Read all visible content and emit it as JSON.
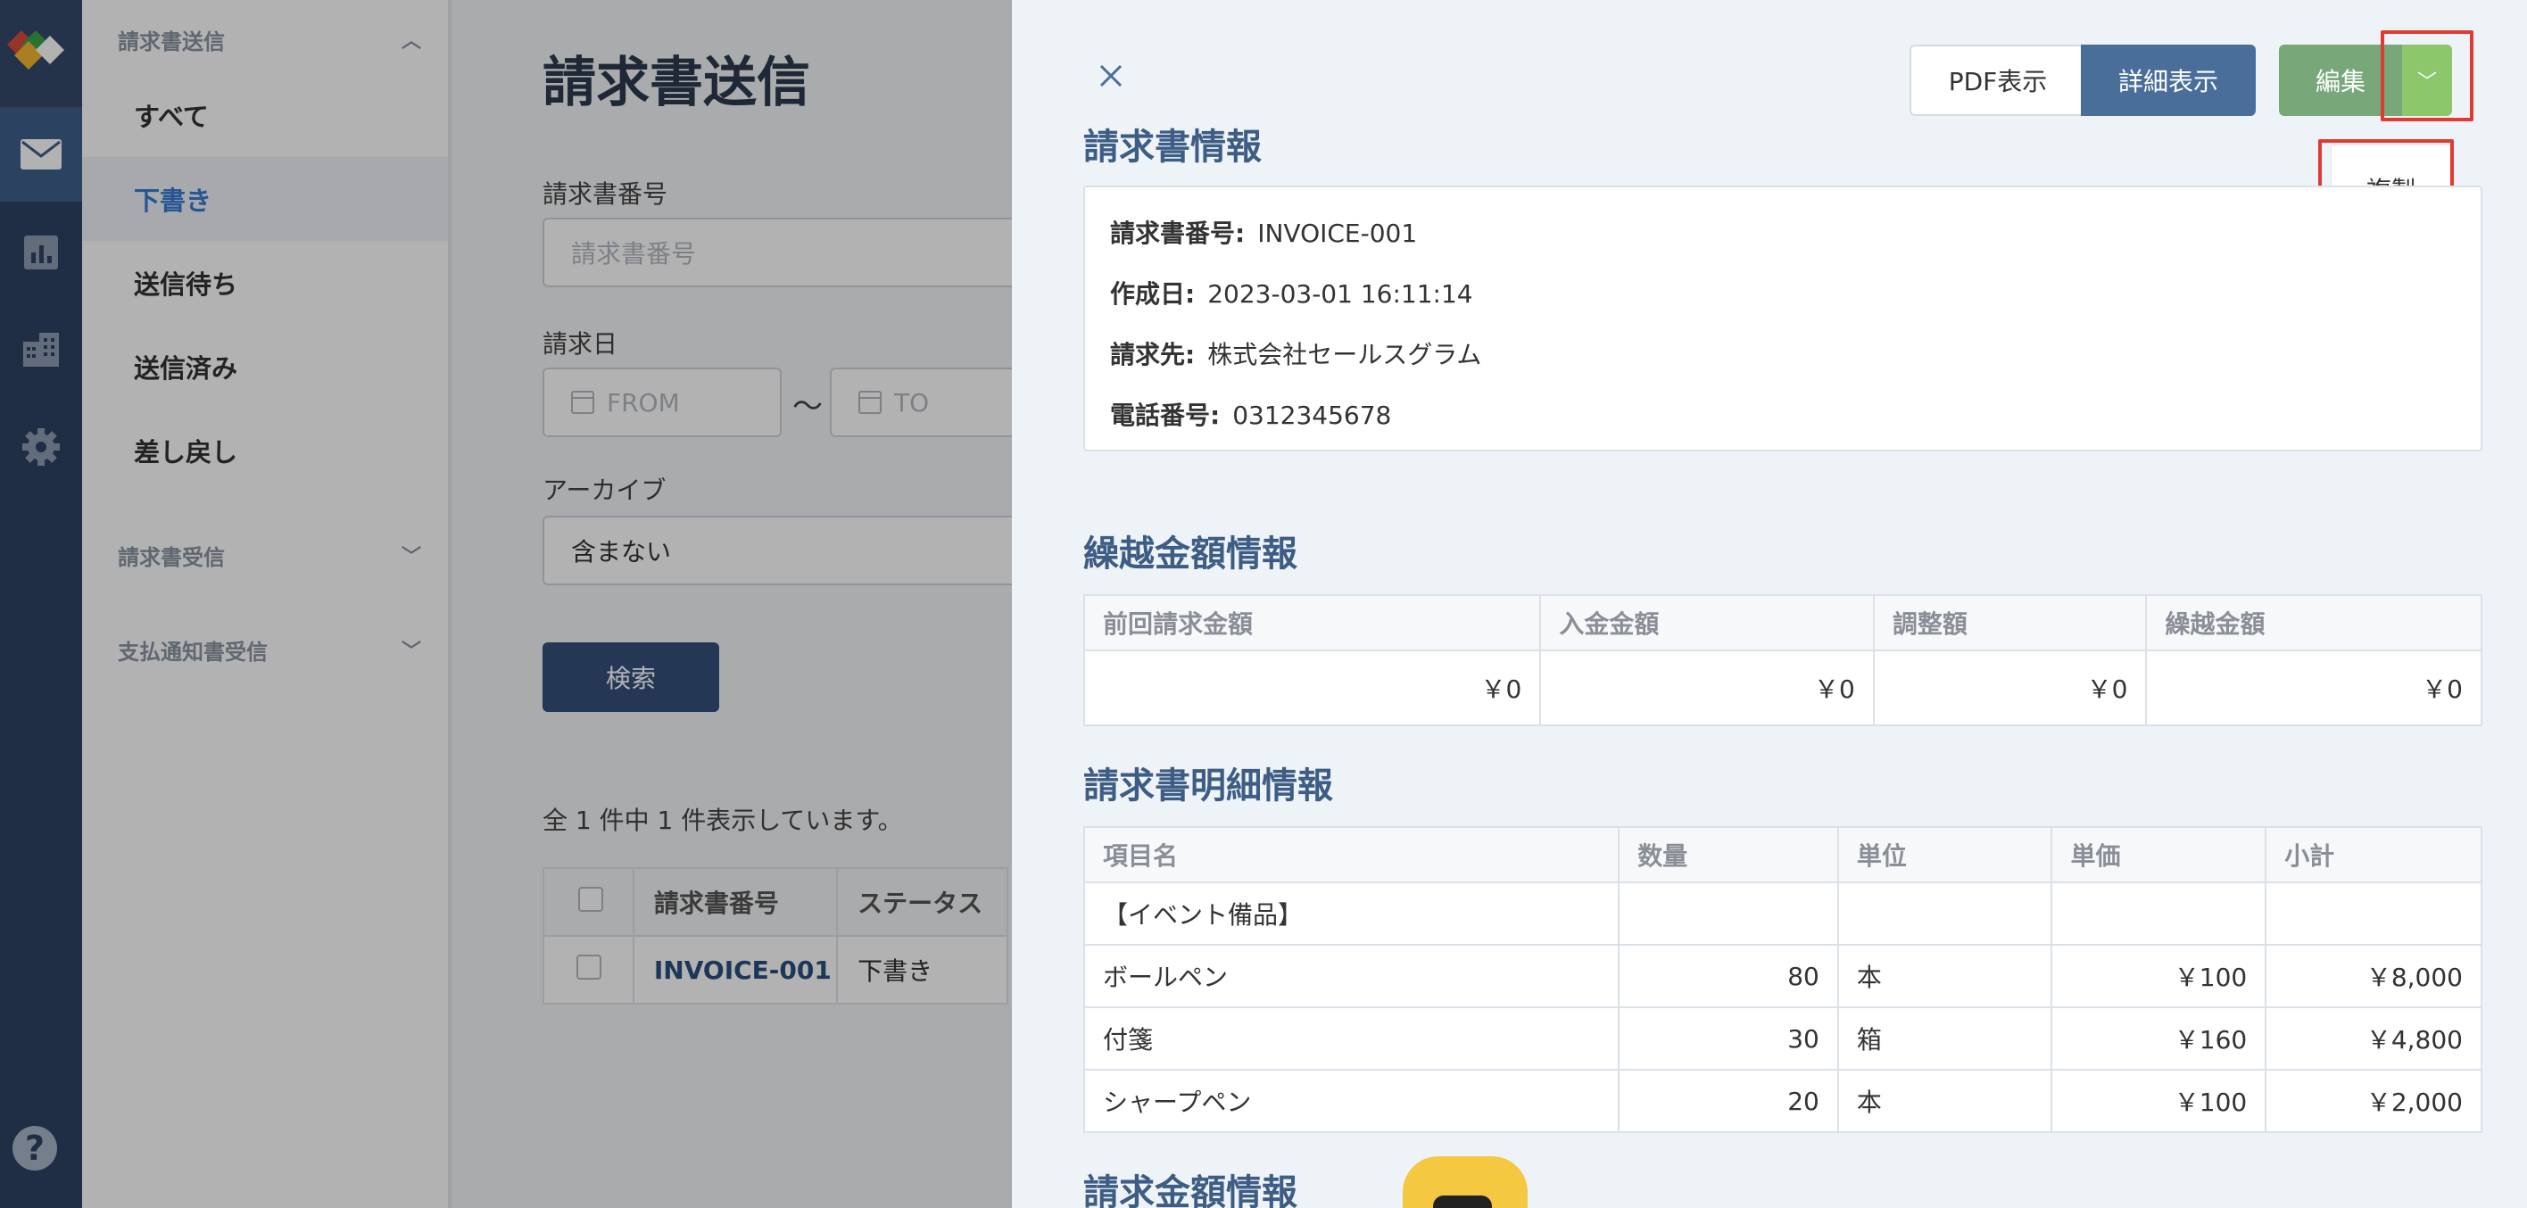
{
  "sidebar": {
    "group_sending": "請求書送信",
    "items": [
      {
        "label": "すべて"
      },
      {
        "label": "下書き"
      },
      {
        "label": "送信待ち"
      },
      {
        "label": "送信済み"
      },
      {
        "label": "差し戻し"
      }
    ],
    "group_receiving": "請求書受信",
    "group_payment": "支払通知書受信"
  },
  "main": {
    "title": "請求書送信",
    "invoice_no_label": "請求書番号",
    "invoice_no_placeholder": "請求書番号",
    "date_label": "請求日",
    "from_placeholder": "FROM",
    "tilde": "〜",
    "to_placeholder": "TO",
    "archive_label": "アーカイブ",
    "archive_value": "含まない",
    "search_button": "検索",
    "count_text": "全 1 件中 1 件表示しています。",
    "table": {
      "headers": [
        "請求書番号",
        "ステータス"
      ],
      "rows": [
        [
          "INVOICE-001",
          "下書き"
        ]
      ]
    }
  },
  "panel": {
    "pdf_button": "PDF表示",
    "detail_button": "詳細表示",
    "edit_button": "編集",
    "dropdown_item": "複製",
    "invoice_info_title": "請求書情報",
    "invoice_info": {
      "no_label": "請求書番号:",
      "no_value": "INVOICE-001",
      "created_label": "作成日:",
      "created_value": "2023-03-01 16:11:14",
      "to_label": "請求先:",
      "to_value": "株式会社セールスグラム",
      "phone_label": "電話番号:",
      "phone_value": "0312345678"
    },
    "carry_title": "繰越金額情報",
    "carry_table": {
      "headers": [
        "前回請求金額",
        "入金金額",
        "調整額",
        "繰越金額"
      ],
      "values": [
        "￥0",
        "￥0",
        "￥0",
        "￥0"
      ]
    },
    "detail_title": "請求書明細情報",
    "detail_table": {
      "headers": [
        "項目名",
        "数量",
        "単位",
        "単価",
        "小計"
      ],
      "rows": [
        [
          "【イベント備品】",
          "",
          "",
          "",
          ""
        ],
        [
          "ボールペン",
          "80",
          "本",
          "￥100",
          "￥8,000"
        ],
        [
          "付箋",
          "30",
          "箱",
          "￥160",
          "￥4,800"
        ],
        [
          "シャープペン",
          "20",
          "本",
          "￥100",
          "￥2,000"
        ]
      ]
    },
    "amount_title": "請求金額情報"
  },
  "colors": {
    "rail": "#2d4262",
    "accent_blue": "#3a7bd5",
    "section_title": "#3d5d84",
    "edit_green": "#78a87a",
    "caret_green": "#8cc76c",
    "highlight_red": "#e03a32"
  }
}
